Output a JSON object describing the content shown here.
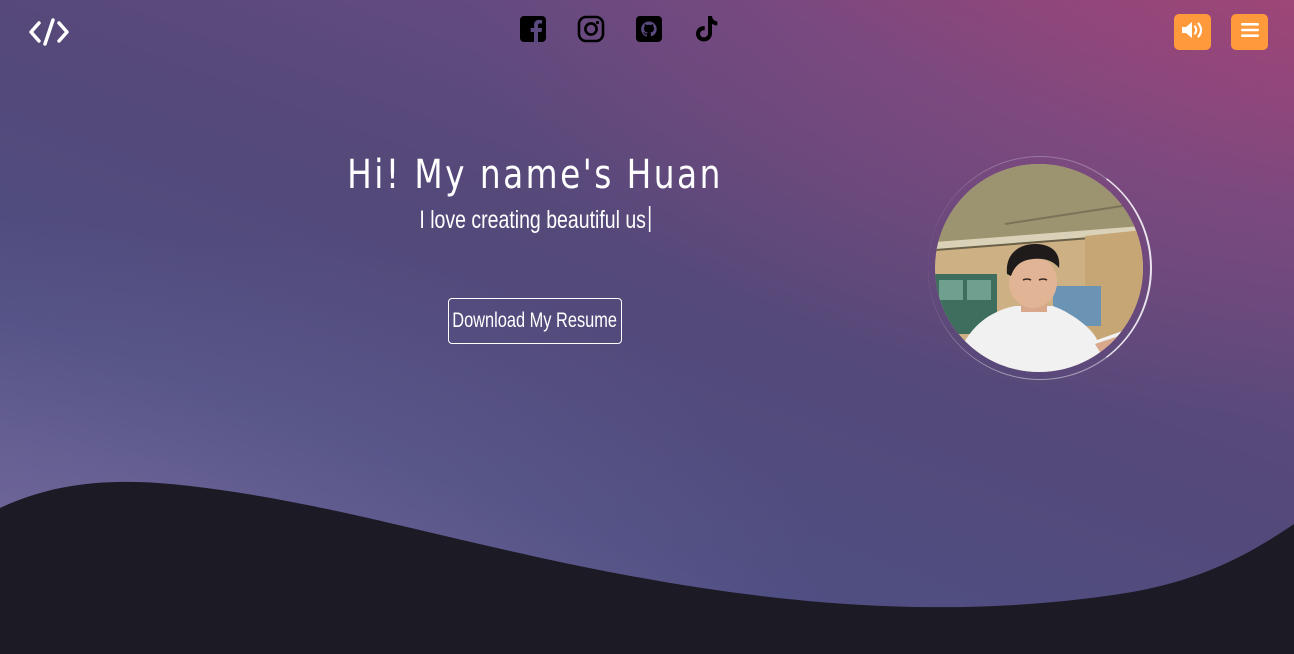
{
  "header": {
    "logo_icon": "code-brackets-icon",
    "social_links": [
      {
        "name": "facebook",
        "icon": "facebook-icon"
      },
      {
        "name": "instagram",
        "icon": "instagram-icon"
      },
      {
        "name": "github",
        "icon": "github-icon"
      },
      {
        "name": "tiktok",
        "icon": "tiktok-icon"
      }
    ],
    "sound_button_icon": "speaker-volume-icon",
    "menu_button_icon": "hamburger-menu-icon"
  },
  "hero": {
    "title": "Hi! My name's Huan",
    "subtitle": "I love creating beautiful us",
    "resume_button": "Download My Resume",
    "avatar_icon": "profile-photo"
  },
  "colors": {
    "accent": "#ff9a3c",
    "wave": "#1c1a24",
    "text": "#ffffff"
  }
}
